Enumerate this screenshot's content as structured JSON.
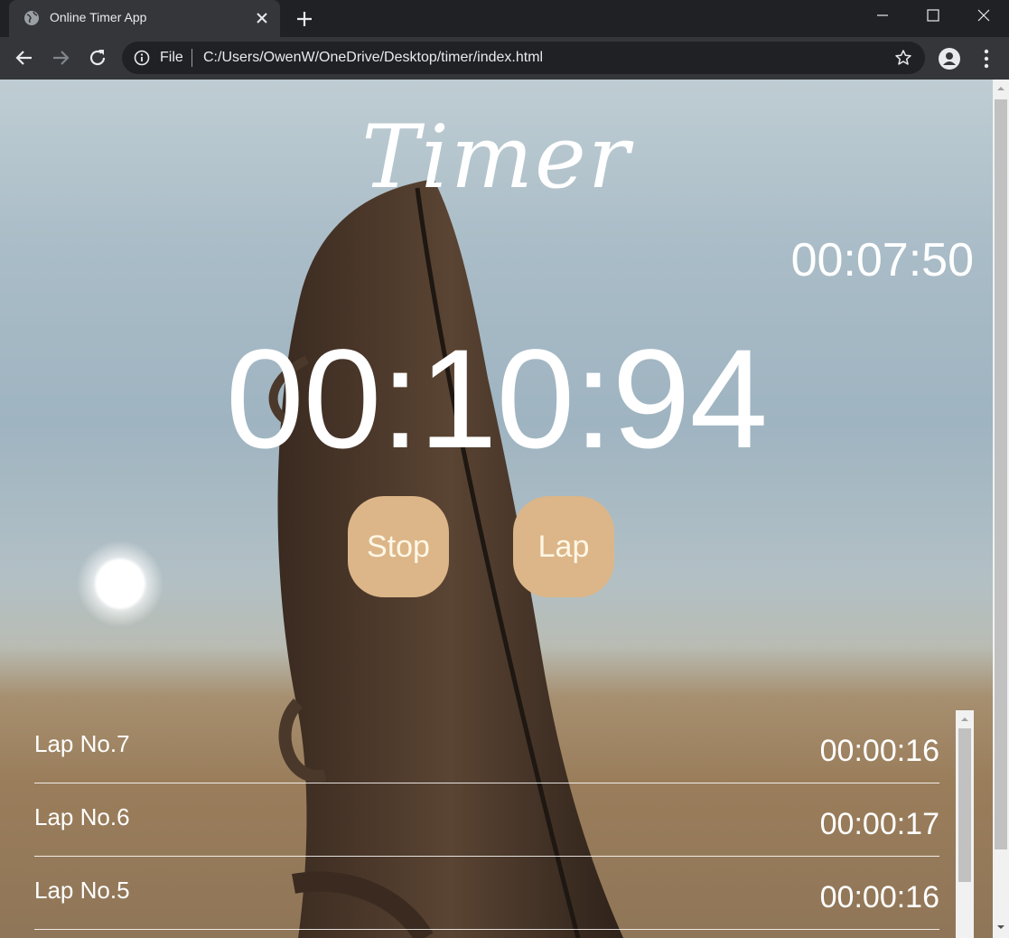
{
  "browser": {
    "tab_title": "Online Timer App",
    "scheme_label": "File",
    "url": "C:/Users/OwenW/OneDrive/Desktop/timer/index.html"
  },
  "page": {
    "title": "Timer",
    "best_time": "00:07:50",
    "current_time": "00:10:94",
    "stop_label": "Stop",
    "lap_label": "Lap",
    "laps": [
      {
        "label": "Lap No.7",
        "time": "00:00:16"
      },
      {
        "label": "Lap No.6",
        "time": "00:00:17"
      },
      {
        "label": "Lap No.5",
        "time": "00:00:16"
      }
    ]
  },
  "colors": {
    "button_bg": "#dcb688",
    "chrome_dark": "#202124",
    "chrome_toolbar": "#35363a"
  }
}
